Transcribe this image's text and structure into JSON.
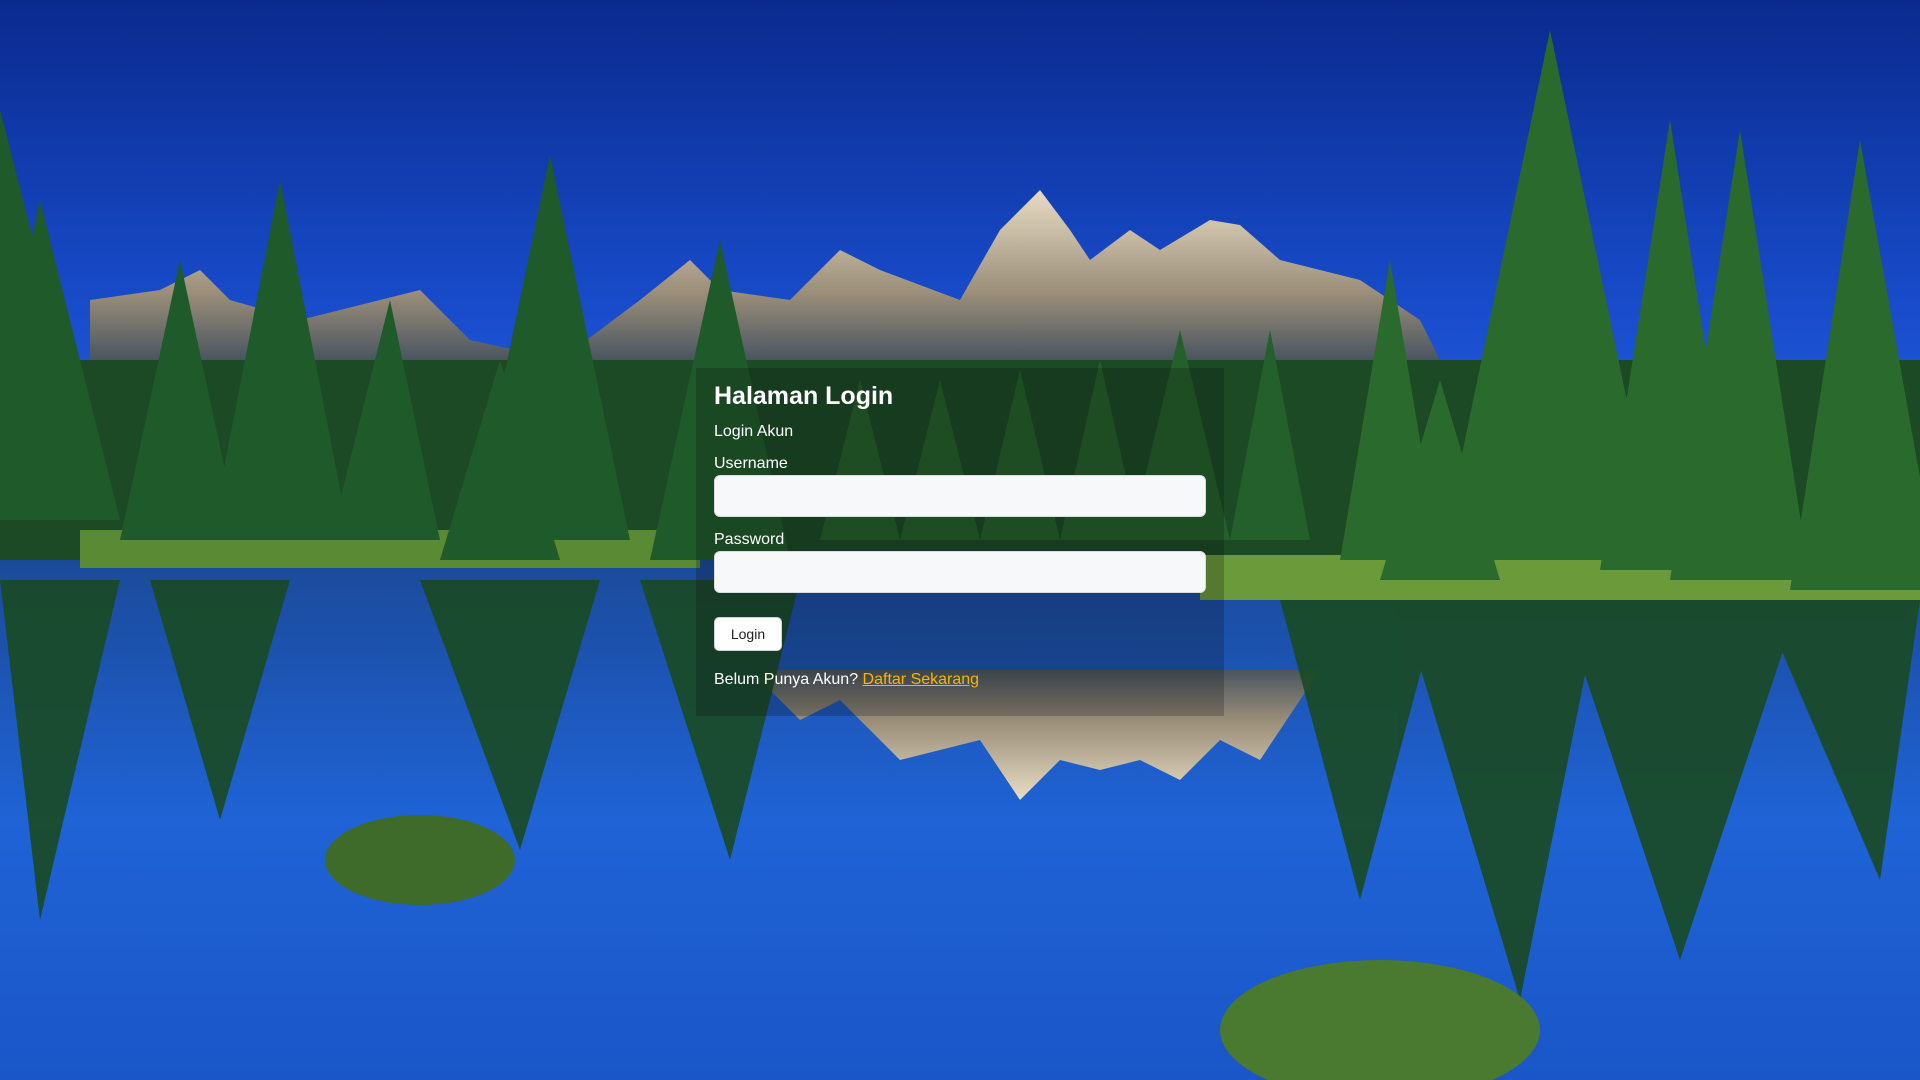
{
  "page": {
    "title": "Halaman Login",
    "subtitle": "Login Akun"
  },
  "form": {
    "username_label": "Username",
    "username_value": "",
    "password_label": "Password",
    "password_value": "",
    "login_button": "Login",
    "register_prompt": "Belum Punya Akun?",
    "register_link": "Daftar Sekarang"
  },
  "colors": {
    "link": "#f7b500",
    "input_bg": "#f7f8fa",
    "text": "#ffffff"
  }
}
